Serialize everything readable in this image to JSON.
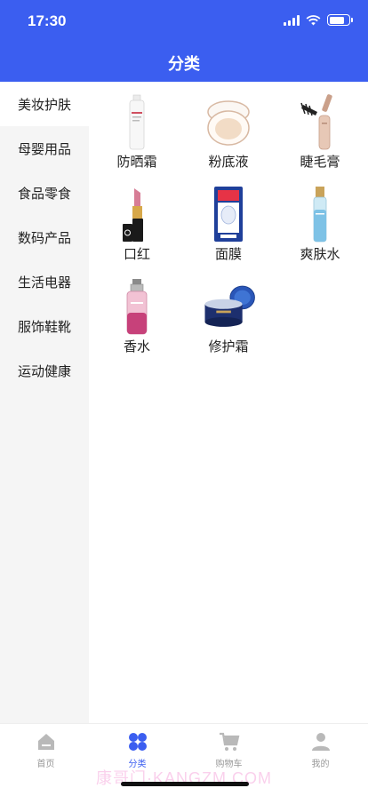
{
  "status_bar": {
    "time": "17:30",
    "battery_level": 0.8
  },
  "header": {
    "title": "分类"
  },
  "sidebar": {
    "items": [
      {
        "label": "美妆护肤",
        "active": true
      },
      {
        "label": "母婴用品",
        "active": false
      },
      {
        "label": "食品零食",
        "active": false
      },
      {
        "label": "数码产品",
        "active": false
      },
      {
        "label": "生活电器",
        "active": false
      },
      {
        "label": "服饰鞋靴",
        "active": false
      },
      {
        "label": "运动健康",
        "active": false
      }
    ]
  },
  "products": [
    {
      "label": "防晒霜",
      "icon": "sunscreen-bottle-icon"
    },
    {
      "label": "粉底液",
      "icon": "cushion-compact-icon"
    },
    {
      "label": "睫毛膏",
      "icon": "mascara-icon"
    },
    {
      "label": "口红",
      "icon": "lipstick-icon"
    },
    {
      "label": "面膜",
      "icon": "face-mask-pack-icon"
    },
    {
      "label": "爽肤水",
      "icon": "toner-bottle-icon"
    },
    {
      "label": "香水",
      "icon": "perfume-bottle-icon"
    },
    {
      "label": "修护霜",
      "icon": "cream-jar-icon"
    }
  ],
  "tabbar": {
    "items": [
      {
        "label": "首页",
        "icon": "home-icon",
        "active": false
      },
      {
        "label": "分类",
        "icon": "category-icon",
        "active": true
      },
      {
        "label": "购物车",
        "icon": "cart-icon",
        "active": false
      },
      {
        "label": "我的",
        "icon": "user-icon",
        "active": false
      }
    ]
  },
  "watermark": "康哥门·KANGZM.COM",
  "colors": {
    "primary": "#3b5ef0",
    "sidebar_bg": "#f5f5f5",
    "inactive_tab": "#999999"
  }
}
